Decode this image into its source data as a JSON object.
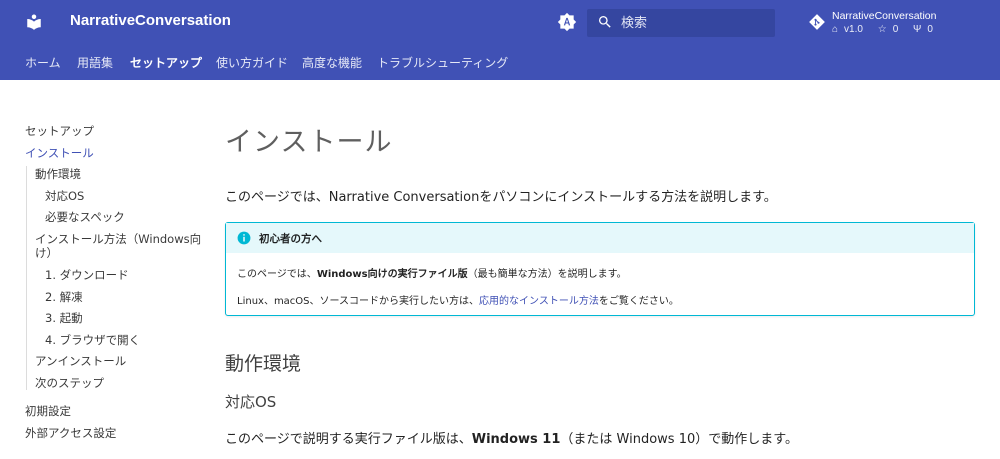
{
  "header": {
    "site_title": "NarrativeConversation",
    "search_placeholder": "検索",
    "repo": {
      "name": "NarrativeConversation",
      "version": "v1.0",
      "stars": "0",
      "forks": "0"
    }
  },
  "tabs": [
    {
      "label": "ホーム",
      "active": false
    },
    {
      "label": "用語集",
      "active": false
    },
    {
      "label": "セットアップ",
      "active": true
    },
    {
      "label": "使い方ガイド",
      "active": false
    },
    {
      "label": "高度な機能",
      "active": false
    },
    {
      "label": "トラブルシューティング",
      "active": false
    }
  ],
  "nav": {
    "section": "セットアップ",
    "current": "インストール",
    "items": [
      {
        "label": "動作環境"
      },
      {
        "label": "対応OS"
      },
      {
        "label": "必要なスペック"
      },
      {
        "label": "インストール方法（Windows向"
      },
      {
        "label": "け）"
      },
      {
        "label": "1. ダウンロード"
      },
      {
        "label": "2. 解凍"
      },
      {
        "label": "3. 起動"
      },
      {
        "label": "4. ブラウザで開く"
      },
      {
        "label": "アンインストール"
      },
      {
        "label": "次のステップ"
      }
    ],
    "after": [
      {
        "label": "初期設定"
      },
      {
        "label": "外部アクセス設定"
      }
    ]
  },
  "page": {
    "title": "インストール",
    "intro": "このページでは、Narrative Conversationをパソコンにインストールする方法を説明します。",
    "admonition": {
      "title": "初心者の方へ",
      "p1_before": "このページでは、",
      "p1_bold": "Windows向けの実行ファイル版",
      "p1_after": "（最も簡単な方法）を説明します。",
      "p2_before": "Linux、macOS、ソースコードから実行したい方は、",
      "p2_link": "応用的なインストール方法",
      "p2_after": "をご覧ください。"
    },
    "h2": "動作環境",
    "h3": "対応OS",
    "p_before": "このページで説明する実行ファイル版は、",
    "p_bold": "Windows 11",
    "p_after": "（または Windows 10）で動作します。"
  }
}
